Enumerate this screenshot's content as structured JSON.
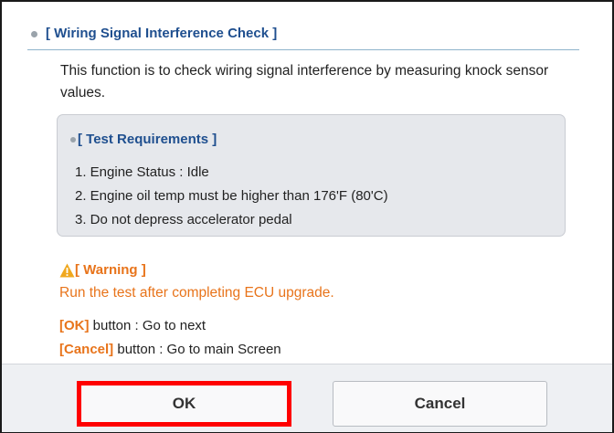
{
  "section": {
    "title": "[ Wiring Signal Interference Check ]",
    "description": "This function is to check wiring signal interference by measuring knock sensor values."
  },
  "requirements": {
    "title": "[ Test Requirements ]",
    "items": [
      "1. Engine Status : Idle",
      "2. Engine oil temp must be higher than 176'F (80'C)",
      "3. Do not depress accelerator pedal"
    ]
  },
  "warning": {
    "icon": "warning-triangle-icon",
    "title": "[ Warning ]",
    "text": "Run the test after completing ECU upgrade."
  },
  "instructions": {
    "ok_key": "[OK]",
    "ok_text": " button : Go to next",
    "cancel_key": "[Cancel]",
    "cancel_text": " button : Go to main Screen"
  },
  "buttons": {
    "ok_label": "OK",
    "cancel_label": "Cancel"
  },
  "colors": {
    "accent_blue": "#1f4f8f",
    "warning_orange": "#e8741b",
    "highlight_red": "#ff0000"
  }
}
